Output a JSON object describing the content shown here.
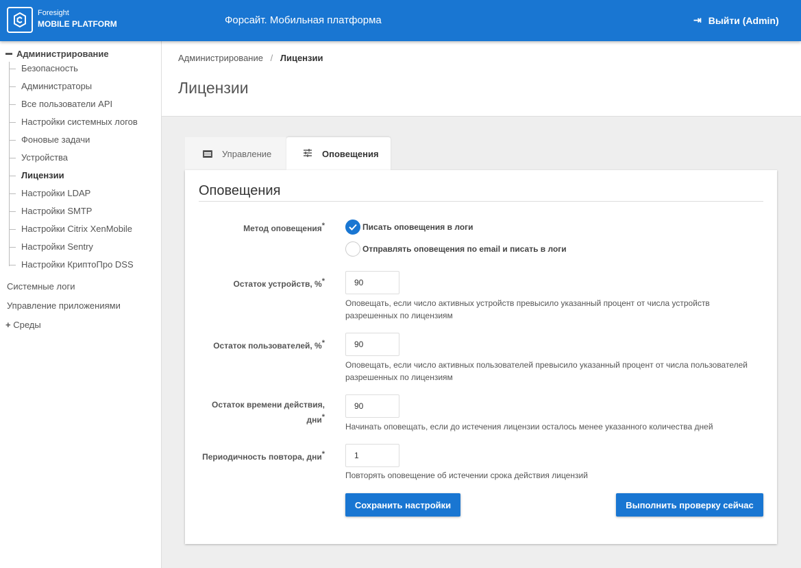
{
  "header": {
    "brand_line1": "Foresight",
    "brand_line2": "MOBILE PLATFORM",
    "title": "Форсайт. Мобильная платформа",
    "logout": "Выйти (Admin)"
  },
  "sidebar": {
    "root": "Администрирование",
    "items": [
      "Безопасность",
      "Администраторы",
      "Все пользователи API",
      "Настройки системных логов",
      "Фоновые задачи",
      "Устройства",
      "Лицензии",
      "Настройки LDAP",
      "Настройки SMTP",
      "Настройки Citrix XenMobile",
      "Настройки Sentry",
      "Настройки КриптоПро DSS"
    ],
    "system_logs": "Системные логи",
    "apps": "Управление приложениями",
    "envs": "Среды"
  },
  "breadcrumb": {
    "parent": "Администрирование",
    "sep": "/",
    "current": "Лицензии"
  },
  "page_title": "Лицензии",
  "tabs": {
    "manage": "Управление",
    "notify": "Оповещения"
  },
  "form": {
    "title": "Оповещения",
    "method_label": "Метод оповещения",
    "required": "*",
    "method_options": [
      "Писать оповещения в логи",
      "Отправлять оповещения по email и писать в логи"
    ],
    "devices_label": "Остаток устройств, %",
    "devices_value": "90",
    "devices_hint": "Оповещать, если число активных устройств превысило указанный процент от числа устройств разрешенных по лицензиям",
    "users_label": "Остаток пользователей, %",
    "users_value": "90",
    "users_hint": "Оповещать, если число активных пользователей превысило указанный процент от числа пользователей разрешенных по лицензиям",
    "time_label1": "Остаток времени действия,",
    "time_label2": "дни",
    "time_value": "90",
    "time_hint": "Начинать оповещать, если до истечения лицензии осталось менее указанного количества дней",
    "repeat_label": "Периодичность повтора, дни",
    "repeat_value": "1",
    "repeat_hint": "Повторять оповещение об истечении срока действия лицензий",
    "save": "Сохранить настройки",
    "check": "Выполнить проверку сейчас"
  }
}
